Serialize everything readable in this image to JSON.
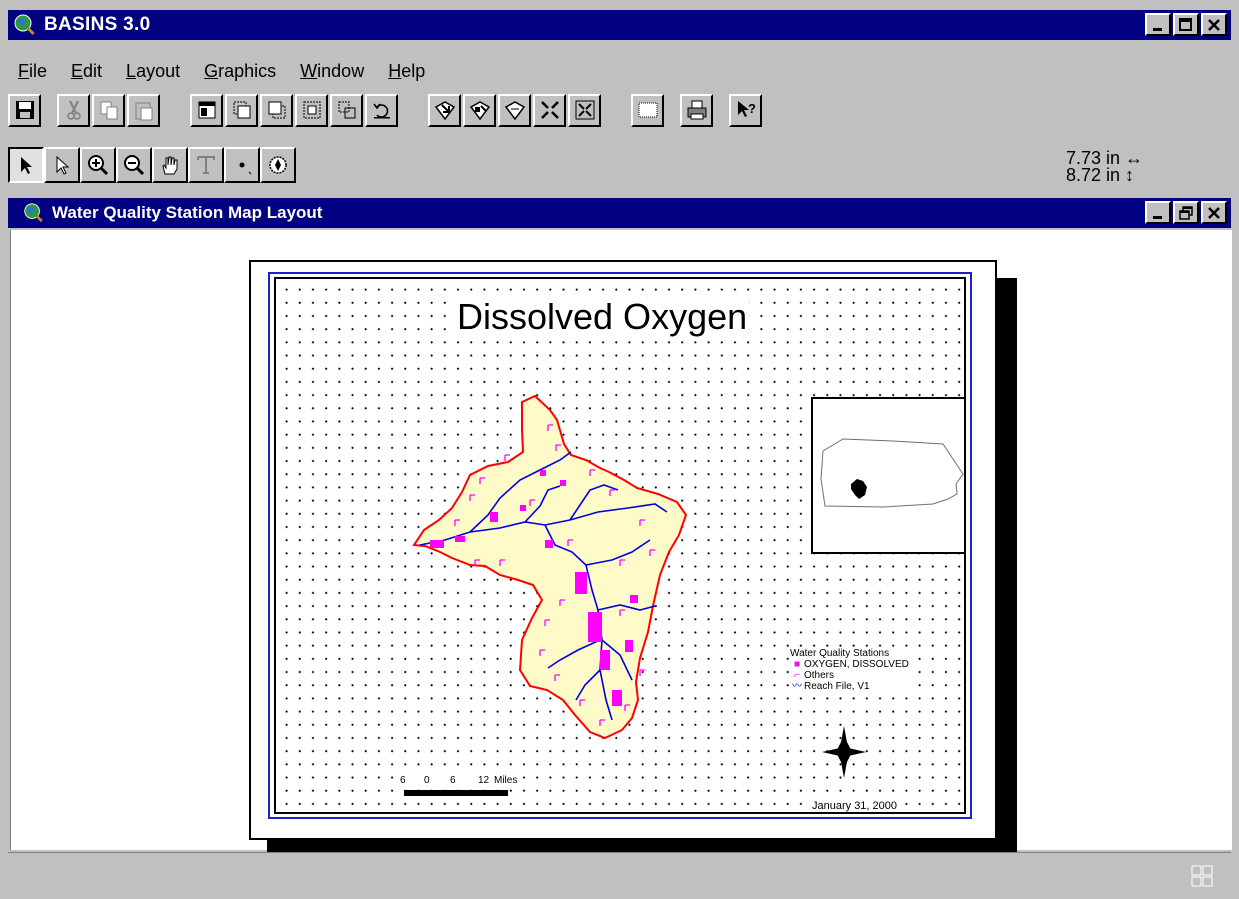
{
  "app": {
    "title": "BASINS 3.0"
  },
  "menu": [
    "File",
    "Edit",
    "Layout",
    "Graphics",
    "Window",
    "Help"
  ],
  "menu_mnemonics": [
    "F",
    "E",
    "L",
    "G",
    "W",
    "H"
  ],
  "readout": {
    "width": "7.73 in",
    "height": "8.72 in"
  },
  "document": {
    "title": "Water Quality Station Map Layout"
  },
  "layout": {
    "map_title": "Dissolved Oxygen",
    "legend": {
      "heading": "Water Quality Stations",
      "items": [
        "OXYGEN, DISSOLVED",
        "Others",
        "Reach File, V1"
      ]
    },
    "scale": {
      "labels": [
        "6",
        "0",
        "6",
        "12",
        "Miles"
      ]
    },
    "date": "January 31, 2000",
    "colors": {
      "watershed_fill": "#fffbc8",
      "watershed_border": "#ff0000",
      "reach": "#0000e0",
      "stations": "#ff00ff",
      "frame": "#2020c0"
    }
  }
}
